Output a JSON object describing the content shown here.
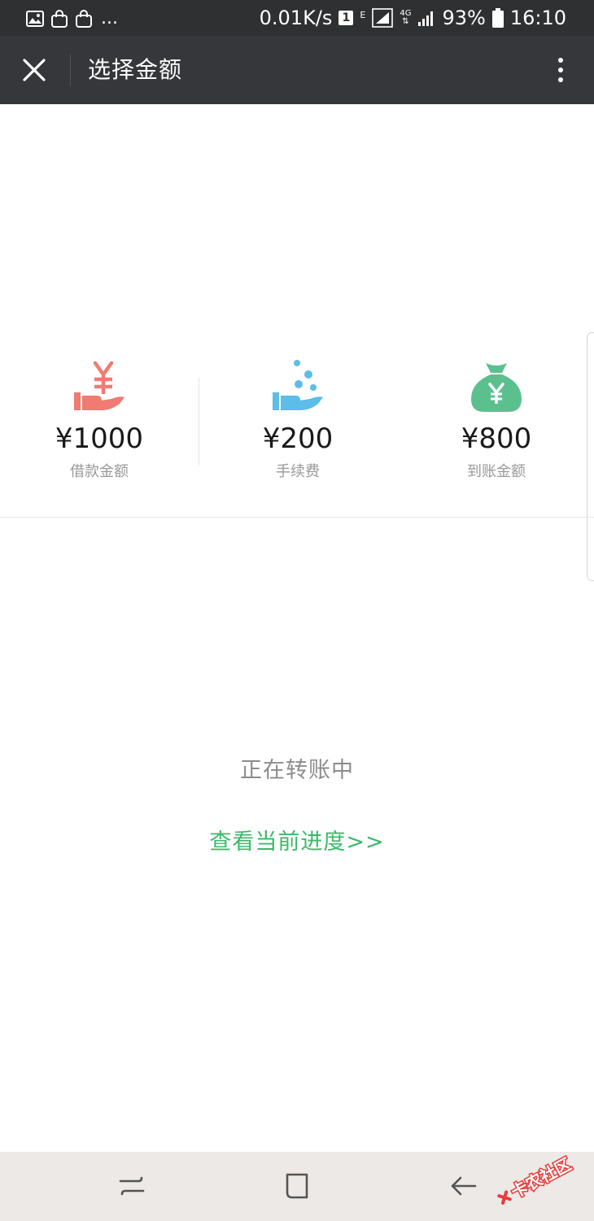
{
  "status_bar": {
    "more": "...",
    "speed": "0.01K/s",
    "sim": "1",
    "net_e": "E",
    "net_4g": "4G",
    "battery": "93%",
    "time": "16:10"
  },
  "app_bar": {
    "title": "选择金额"
  },
  "stats": [
    {
      "amount": "¥1000",
      "label": "借款金额",
      "icon": "hand-yuan-icon",
      "color": "#ef7b73"
    },
    {
      "amount": "¥200",
      "label": "手续费",
      "icon": "hand-coins-icon",
      "color": "#5bbde8"
    },
    {
      "amount": "¥800",
      "label": "到账金额",
      "icon": "money-bag-icon",
      "color": "#5cc08e"
    }
  ],
  "status_text": "正在转账中",
  "progress_link": "查看当前进度>>",
  "watermark": "卡农社区",
  "colors": {
    "status_bar": "#2f3032",
    "app_bar": "#36373a",
    "link": "#3cb96a",
    "nav_bar": "#ece9e6"
  }
}
